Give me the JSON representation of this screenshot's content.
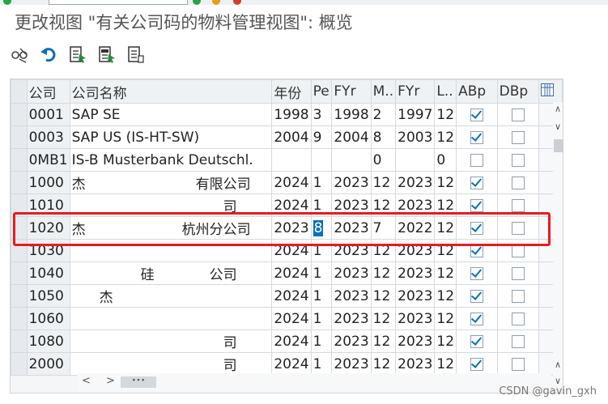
{
  "window": {
    "title": "更改视图 \"有关公司码的物料管理视图\": 概览"
  },
  "toolbar": {
    "buttons": [
      {
        "icon": "glasses-icon"
      },
      {
        "icon": "undo-icon"
      },
      {
        "icon": "select-all-icon"
      },
      {
        "icon": "select-block-icon"
      },
      {
        "icon": "deselect-all-icon"
      }
    ]
  },
  "grid": {
    "columns": [
      "公司",
      "公司名称",
      "年份",
      "Pe",
      "FYr",
      "M..",
      "FYr",
      "L..",
      "ABp",
      "DBp"
    ],
    "rows": [
      {
        "code": "0001",
        "name": "SAP SE",
        "year": "1998",
        "pe": "3",
        "fyr": "1998",
        "m": "2",
        "fyr2": "1997",
        "l": "12",
        "abp": true,
        "dbp": false
      },
      {
        "code": "0003",
        "name": "SAP US (IS-HT-SW)",
        "year": "2004",
        "pe": "9",
        "fyr": "2004",
        "m": "8",
        "fyr2": "2003",
        "l": "12",
        "abp": true,
        "dbp": false
      },
      {
        "code": "0MB1",
        "name": "IS-B Musterbank Deutschl.",
        "year": "",
        "pe": "",
        "fyr": "",
        "m": "0",
        "fyr2": "",
        "l": "0",
        "abp": false,
        "dbp": false
      },
      {
        "code": "1000",
        "name": "杰　　　　　　　　有限公司",
        "year": "2024",
        "pe": "1",
        "fyr": "2023",
        "m": "12",
        "fyr2": "2023",
        "l": "12",
        "abp": true,
        "dbp": false
      },
      {
        "code": "1010",
        "name": "　　　　　　　　　　　司",
        "year": "2024",
        "pe": "1",
        "fyr": "2023",
        "m": "12",
        "fyr2": "2023",
        "l": "12",
        "abp": true,
        "dbp": false
      },
      {
        "code": "1020",
        "name": "杰　　　　　　　杭州分公司",
        "year": "2023",
        "pe": "8",
        "fyr": "2023",
        "m": "7",
        "fyr2": "2022",
        "l": "12",
        "abp": true,
        "dbp": false
      },
      {
        "code": "1030",
        "name": "　　　　　　　　　　　　",
        "year": "2024",
        "pe": "1",
        "fyr": "2023",
        "m": "12",
        "fyr2": "2023",
        "l": "12",
        "abp": true,
        "dbp": false
      },
      {
        "code": "1040",
        "name": "　　　　　硅　　　　公司",
        "year": "2024",
        "pe": "1",
        "fyr": "2023",
        "m": "12",
        "fyr2": "2023",
        "l": "12",
        "abp": true,
        "dbp": false
      },
      {
        "code": "1050",
        "name": "　　杰　　　　　　　　　",
        "year": "2024",
        "pe": "1",
        "fyr": "2023",
        "m": "12",
        "fyr2": "2023",
        "l": "12",
        "abp": true,
        "dbp": false
      },
      {
        "code": "1060",
        "name": "　　　　　　　　　　　　",
        "year": "2024",
        "pe": "1",
        "fyr": "2023",
        "m": "12",
        "fyr2": "2023",
        "l": "12",
        "abp": true,
        "dbp": false
      },
      {
        "code": "1080",
        "name": "　　　　　　　　　　　司",
        "year": "2024",
        "pe": "1",
        "fyr": "2023",
        "m": "12",
        "fyr2": "2023",
        "l": "12",
        "abp": true,
        "dbp": false
      },
      {
        "code": "2000",
        "name": "　　　　　　　　　　　司",
        "year": "2024",
        "pe": "1",
        "fyr": "2023",
        "m": "12",
        "fyr2": "2023",
        "l": "12",
        "abp": true,
        "dbp": false
      }
    ],
    "highlighted_row": "1020"
  },
  "watermark": "CSDN @gavin_gxh",
  "colors": {
    "accent": "#0a6fb8",
    "highlight_border": "#e51c23"
  }
}
